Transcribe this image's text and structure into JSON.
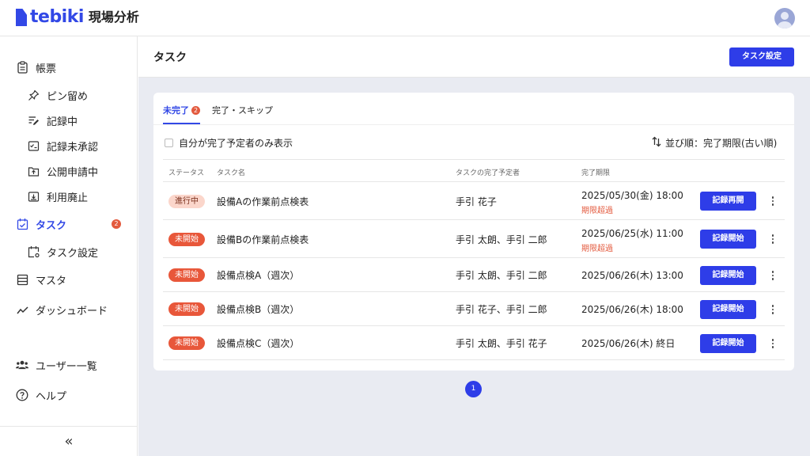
{
  "brand": {
    "name": "tebiki",
    "product": "現場分析"
  },
  "sidebar": {
    "items": [
      {
        "label": "帳票"
      },
      {
        "label": "ピン留め"
      },
      {
        "label": "記録中"
      },
      {
        "label": "記録未承認"
      },
      {
        "label": "公開申請中"
      },
      {
        "label": "利用廃止"
      },
      {
        "label": "タスク",
        "badge": "2"
      },
      {
        "label": "タスク設定"
      },
      {
        "label": "マスタ"
      },
      {
        "label": "ダッシュボード"
      },
      {
        "label": "ユーザー一覧"
      },
      {
        "label": "ヘルプ"
      }
    ],
    "collapse": "«"
  },
  "header": {
    "title": "タスク",
    "settings_button": "タスク設定"
  },
  "tabs": [
    {
      "label": "未完了",
      "badge": "2"
    },
    {
      "label": "完了・スキップ"
    }
  ],
  "filter": {
    "label": "自分が完了予定者のみ表示"
  },
  "sort": {
    "label": "並び順：完了期限(古い順)"
  },
  "table": {
    "headers": [
      "ステータス",
      "タスク名",
      "タスクの完了予定者",
      "完了期限"
    ],
    "rows": [
      {
        "status": "進行中",
        "name": "設備Aの作業前点検表",
        "assignee": "手引 花子",
        "deadline": "2025/05/30(金) 18:00",
        "overdue": "期限超過",
        "action": "記録再開"
      },
      {
        "status": "未開始",
        "name": "設備Bの作業前点検表",
        "assignee": "手引 太朗、手引 二郎",
        "deadline": "2025/06/25(水) 11:00",
        "overdue": "期限超過",
        "action": "記録開始"
      },
      {
        "status": "未開始",
        "name": "設備点検A（週次）",
        "assignee": "手引 太朗、手引 二郎",
        "deadline": "2025/06/26(木) 13:00",
        "action": "記録開始"
      },
      {
        "status": "未開始",
        "name": "設備点検B（週次）",
        "assignee": "手引 花子、手引 二郎",
        "deadline": "2025/06/26(木) 18:00",
        "action": "記録開始"
      },
      {
        "status": "未開始",
        "name": "設備点検C（週次）",
        "assignee": "手引 太朗、手引 花子",
        "deadline": "2025/06/26(木) 終日",
        "action": "記録開始"
      }
    ]
  },
  "pagination": {
    "current": "1"
  },
  "colors": {
    "accent": "#2e3de8",
    "danger": "#e35a3e",
    "background": "#e9ebf2"
  }
}
